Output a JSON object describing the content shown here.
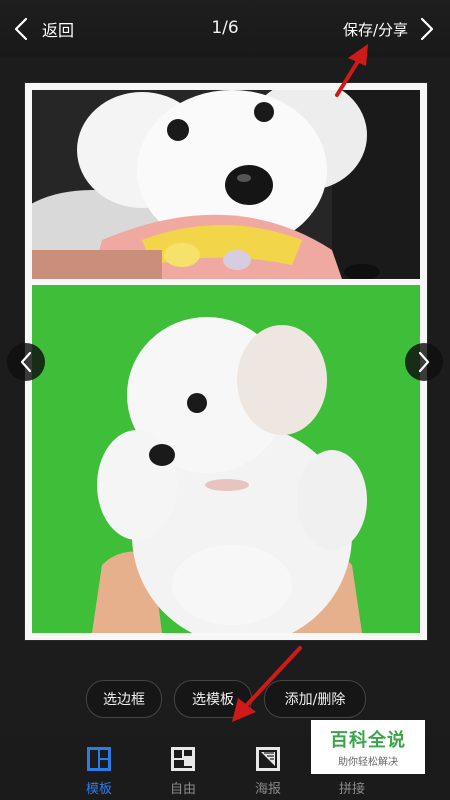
{
  "header": {
    "back_label": "返回",
    "page_counter": "1/6",
    "save_label": "保存/分享"
  },
  "toolbar": {
    "border_label": "选边框",
    "template_label": "选模板",
    "add_delete_label": "添加/删除"
  },
  "tabs": [
    {
      "label": "模板",
      "icon": "template-grid-icon",
      "active": true
    },
    {
      "label": "自由",
      "icon": "free-layout-icon",
      "active": false
    },
    {
      "label": "海报",
      "icon": "poster-icon",
      "active": false
    },
    {
      "label": "拼接",
      "icon": "stitch-icon",
      "active": false
    }
  ],
  "watermark": {
    "main": "百科全说",
    "sub": "助你轻松解决"
  },
  "colors": {
    "accent": "#2c7ce6",
    "annotation_arrow": "#d01a1a",
    "green_backdrop": "#3fbe3a"
  }
}
